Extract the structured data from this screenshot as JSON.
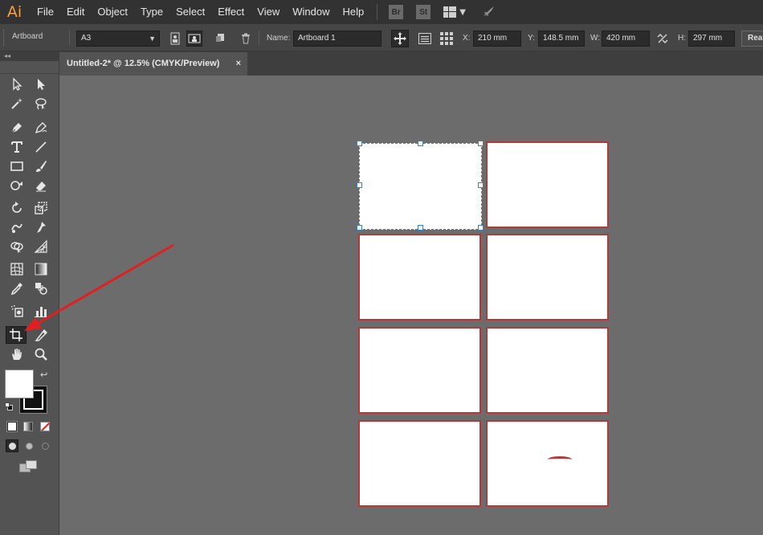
{
  "app": {
    "logo": "Ai",
    "accent": "#f7a04a"
  },
  "menu": [
    "File",
    "Edit",
    "Object",
    "Type",
    "Select",
    "Effect",
    "View",
    "Window",
    "Help"
  ],
  "app_buttons": {
    "bridge": "Br",
    "stock": "St"
  },
  "control_bar": {
    "tool_label": "Artboard",
    "preset": "A3",
    "name_label": "Name:",
    "name_value": "Artboard 1",
    "x_label": "X:",
    "x_value": "210 mm",
    "y_label": "Y:",
    "y_value": "148.5 mm",
    "w_label": "W:",
    "w_value": "420 mm",
    "h_label": "H:",
    "h_value": "297 mm",
    "rearrange_label": "Rear"
  },
  "tab": {
    "title": "Untitled-2* @ 12.5% (CMYK/Preview)",
    "close": "×"
  },
  "toolbox": {
    "collapse": "◂◂",
    "selected_tool": "artboard-tool",
    "fill_color": "#ffffff",
    "stroke_color": "#000000"
  },
  "canvas": {
    "artboard_count": 8,
    "artboard_border_color": "#b23a3a",
    "selection_color": "#3b7fc4",
    "annotation_arrow_color": "#e02020"
  }
}
